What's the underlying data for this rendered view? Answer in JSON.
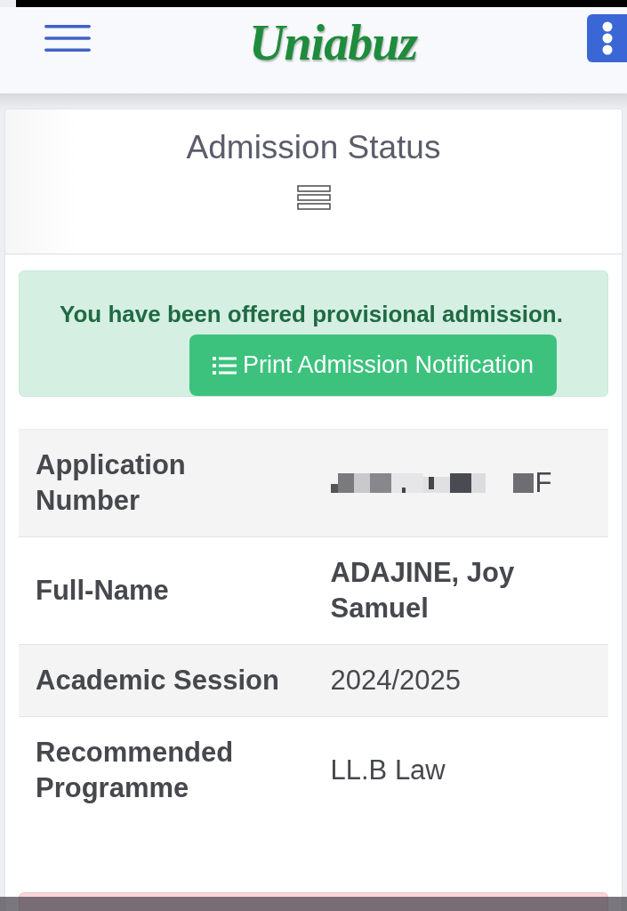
{
  "navbar": {
    "logo": "Uniabuz"
  },
  "card": {
    "title": "Admission Status",
    "alert": {
      "kind": "success",
      "message": "You have been offered provisional admission.",
      "button": "Print Admission Notification"
    },
    "details": [
      {
        "label": "Application Number",
        "value": "F",
        "redacted": true,
        "bold": false
      },
      {
        "label": "Full-Name",
        "value": "ADAJINE, Joy Samuel",
        "redacted": false,
        "bold": true
      },
      {
        "label": "Academic Session",
        "value": "2024/2025",
        "redacted": false,
        "bold": false
      },
      {
        "label": "Recommended Programme",
        "value": "LL.B Law",
        "redacted": false,
        "bold": false
      }
    ],
    "next_alert": {
      "kind": "danger"
    }
  }
}
